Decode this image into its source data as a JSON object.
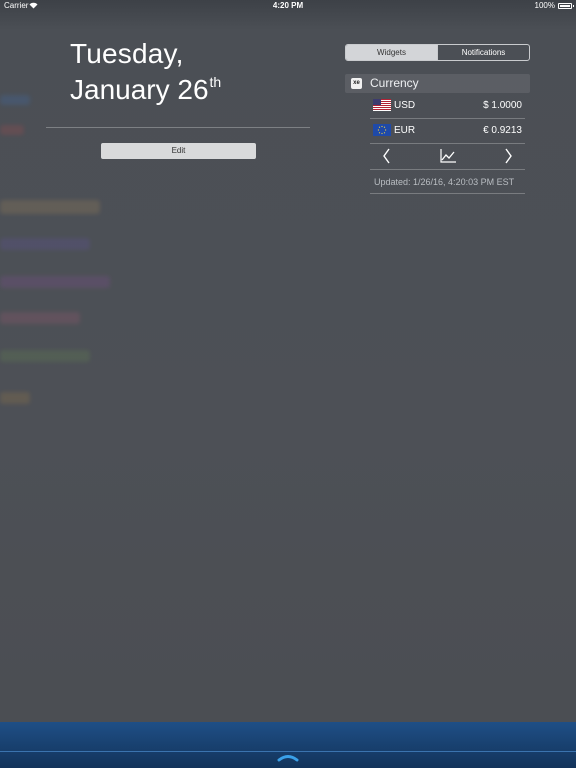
{
  "status_bar": {
    "carrier": "Carrier",
    "time": "4:20 PM",
    "battery": "100%"
  },
  "date": {
    "weekday": "Tuesday,",
    "month_day": "January 26",
    "ordinal": "th"
  },
  "edit_label": "Edit",
  "tabs": [
    {
      "label": "Widgets",
      "selected": true
    },
    {
      "label": "Notifications",
      "selected": false
    }
  ],
  "widget": {
    "logo": "xe",
    "title": "Currency",
    "rates": [
      {
        "code": "USD",
        "amount": "$ 1.0000",
        "flag": "us-flag-icon"
      },
      {
        "code": "EUR",
        "amount": "€ 0.9213",
        "flag": "eu-flag-icon"
      }
    ],
    "updated": "Updated: 1/26/16, 4:20:03 PM EST"
  },
  "colors": {
    "background": "#4b4f55",
    "bottom_bar": "#1a4577",
    "handle": "#3aa0e8"
  }
}
